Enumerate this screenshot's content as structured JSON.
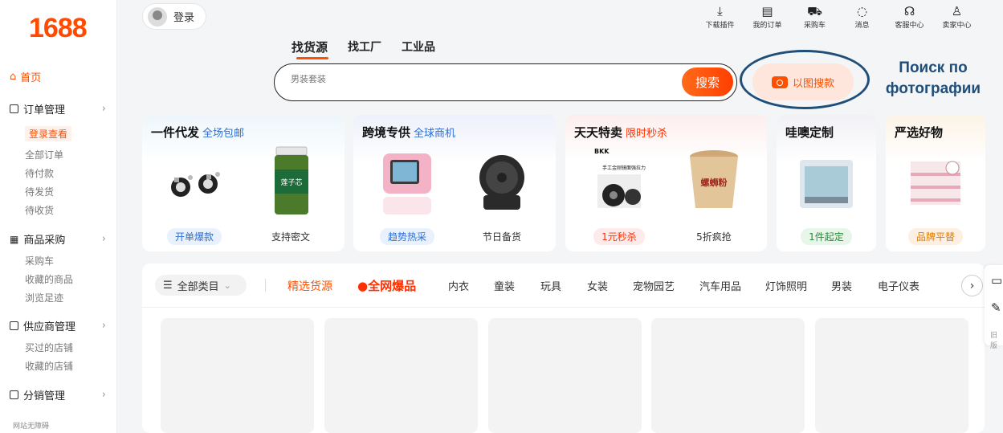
{
  "sidebar": {
    "logo": "1688",
    "home": "首页",
    "sections": [
      {
        "label": "订单管理",
        "items": [
          "登录查看",
          "全部订单",
          "待付款",
          "待发货",
          "待收货"
        ]
      },
      {
        "label": "商品采购",
        "items": [
          "采购车",
          "收藏的商品",
          "浏览足迹"
        ]
      },
      {
        "label": "供应商管理",
        "items": [
          "买过的店铺",
          "收藏的店铺"
        ]
      },
      {
        "label": "分销管理",
        "items": []
      }
    ],
    "footer": "网站无障碍"
  },
  "header": {
    "login": "登录",
    "nav": [
      {
        "label": "下载插件",
        "icon": "download-icon"
      },
      {
        "label": "我的订单",
        "icon": "order-icon"
      },
      {
        "label": "采购车",
        "icon": "cart-icon"
      },
      {
        "label": "消息",
        "icon": "message-icon"
      },
      {
        "label": "客服中心",
        "icon": "headset-icon"
      },
      {
        "label": "卖家中心",
        "icon": "user-icon"
      }
    ]
  },
  "search": {
    "tabs": [
      "找货源",
      "找工厂",
      "工业品"
    ],
    "placeholder": "男装套装",
    "button": "搜索",
    "image_search": "以图搜款"
  },
  "annotation": {
    "line1": "Поиск по",
    "line2": "фотографии"
  },
  "cards": [
    {
      "title": "一件代发",
      "subtitle": "全场包邮",
      "subtitle_color": "#2b6fd6",
      "products": [
        {
          "label": "开单爆款",
          "style": "blue"
        },
        {
          "label": "支持密文",
          "style": "plain"
        }
      ]
    },
    {
      "title": "跨境专供",
      "subtitle": "全球商机",
      "subtitle_color": "#2b6fd6",
      "products": [
        {
          "label": "趋势热采",
          "style": "blue"
        },
        {
          "label": "节日备货",
          "style": "plain"
        }
      ]
    },
    {
      "title": "天天特卖",
      "subtitle": "限时秒杀",
      "subtitle_color": "#ff3000",
      "products": [
        {
          "label": "1元秒杀",
          "style": "red"
        },
        {
          "label": "5折疯抢",
          "style": "plain"
        }
      ]
    },
    {
      "title": "哇噢定制",
      "subtitle": "",
      "subtitle_color": "#2b6fd6",
      "products": [
        {
          "label": "1件起定",
          "style": "green"
        }
      ]
    },
    {
      "title": "严选好物",
      "subtitle": "",
      "subtitle_color": "#2b6fd6",
      "products": [
        {
          "label": "品牌平替",
          "style": "orange"
        }
      ]
    }
  ],
  "product_images": {
    "earrings_brand": "",
    "jar_label": "莲子芯",
    "bag_brand": "BKK",
    "bag_text": "手工金刚镜面强拉力",
    "cup_text": "螺蛳粉"
  },
  "categories": {
    "all": "全部类目",
    "featured": "精选货源",
    "hot": "全网爆品",
    "items": [
      "内衣",
      "童装",
      "玩具",
      "女装",
      "宠物园艺",
      "汽车用品",
      "灯饰照明",
      "男装",
      "电子仪表"
    ]
  },
  "float_tools": {
    "label": "旧版"
  },
  "colors": {
    "brand": "#ff5000",
    "annotation": "#1f4e79"
  }
}
